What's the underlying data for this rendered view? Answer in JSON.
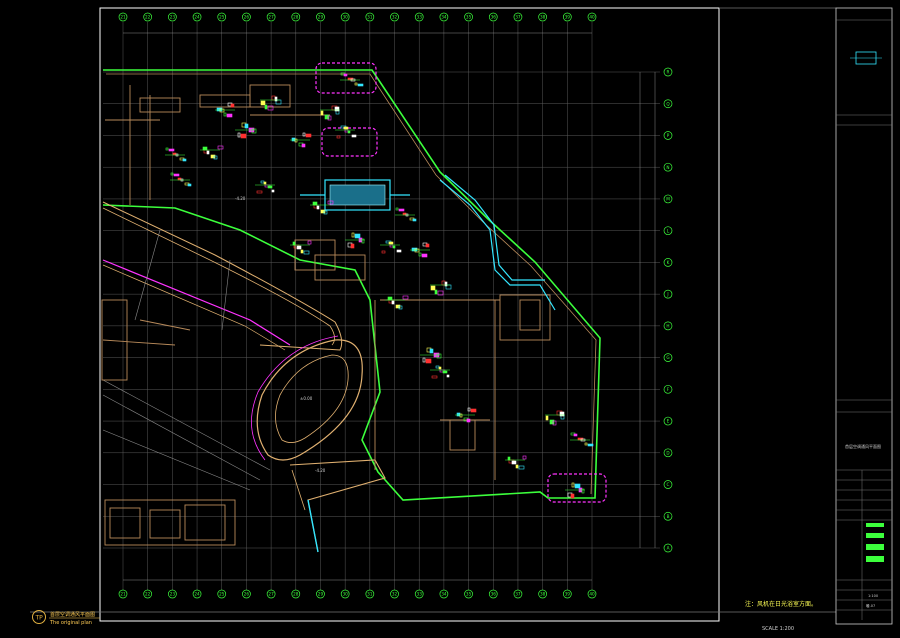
{
  "drawing": {
    "column_labels": [
      "21",
      "22",
      "23",
      "24",
      "25",
      "26",
      "27",
      "28",
      "29",
      "30",
      "31",
      "32",
      "33",
      "34",
      "35",
      "36",
      "37",
      "38",
      "39",
      "40"
    ],
    "row_labels": [
      "R",
      "Q",
      "P",
      "N",
      "M",
      "L",
      "K",
      "J",
      "H",
      "G",
      "F",
      "E",
      "D",
      "C",
      "B",
      "A"
    ],
    "rooms": [
      {
        "label": "±0.00"
      },
      {
        "label": "-4.20"
      },
      {
        "label": "-4.20"
      }
    ]
  },
  "title_block": {
    "logo_text": "TP",
    "plan_title_cn": "首层空调通风平面图",
    "plan_title_en": "The original plan",
    "scale_text": "SCALE 1:200",
    "note_text": "注：风机在日光浴室方面。",
    "drawing_name": "首层空调通风平面图",
    "drawing_no": "1:100",
    "sheet_no": "暖-07"
  },
  "colors": {
    "background": "#000000",
    "frame": "#ffffff",
    "grid": "#6b6b6b",
    "green": "#3cff3c",
    "magenta": "#ff33ff",
    "cyan": "#33e6ff",
    "yellow": "#ffff55",
    "red": "#ff3030",
    "brown": "#b88a5a",
    "gray": "#8a8a8a"
  }
}
